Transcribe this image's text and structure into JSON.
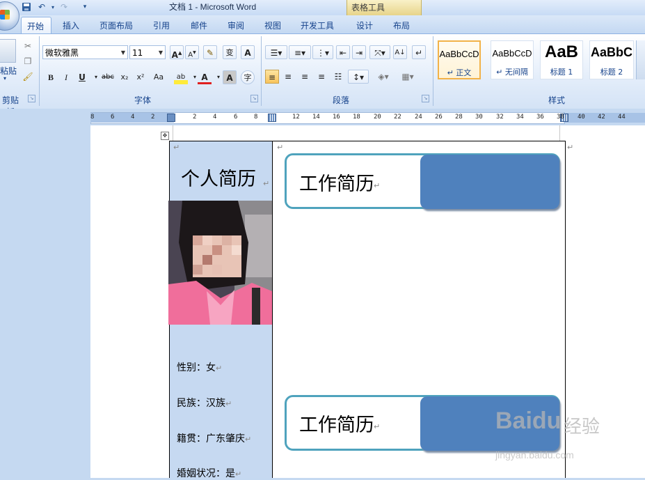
{
  "window": {
    "title": "文档 1 - Microsoft Word",
    "contextual_tools": "表格工具"
  },
  "tabs": [
    {
      "label": "开始",
      "active": true
    },
    {
      "label": "插入"
    },
    {
      "label": "页面布局"
    },
    {
      "label": "引用"
    },
    {
      "label": "邮件"
    },
    {
      "label": "审阅"
    },
    {
      "label": "视图"
    },
    {
      "label": "开发工具"
    },
    {
      "label": "设计"
    },
    {
      "label": "布局"
    }
  ],
  "ribbon": {
    "clipboard": {
      "label": "剪贴板",
      "paste_label": "粘贴"
    },
    "font": {
      "label": "字体",
      "font_name": "微软雅黑",
      "font_size": "11",
      "grow": "A",
      "shrink": "A",
      "bold": "B",
      "italic": "I",
      "underline": "U",
      "strike": "abc",
      "subscript": "x₂",
      "superscript": "x²",
      "change_case": "Aa",
      "highlight": "ab",
      "font_color": "A",
      "char_shading": "A",
      "enclose": "字",
      "phonetic": "变"
    },
    "paragraph": {
      "label": "段落"
    },
    "styles": {
      "label": "样式",
      "items": [
        {
          "sample": "AaBbCcD",
          "name": "↵ 正文",
          "selected": true
        },
        {
          "sample": "AaBbCcD",
          "name": "↵ 无间隔"
        },
        {
          "sample": "AaB",
          "name": "标题 1"
        },
        {
          "sample": "AaBbC",
          "name": "标题 2"
        }
      ]
    }
  },
  "ruler": {
    "left_ticks": [
      "8",
      "6",
      "4",
      "2"
    ],
    "right_ticks": [
      "2",
      "4",
      "6",
      "8",
      "12",
      "14",
      "16",
      "18",
      "20",
      "22",
      "24",
      "26",
      "28",
      "30",
      "32",
      "34",
      "36",
      "38",
      "40",
      "42",
      "44"
    ]
  },
  "document": {
    "title": "个人简历",
    "sections": [
      "工作简历",
      "工作简历"
    ],
    "info": [
      "性别：女",
      "民族：汉族",
      "籍贯：广东肇庆",
      "婚姻状况：是"
    ],
    "para_mark": "↵"
  },
  "watermark": {
    "logo": "Baidu",
    "text": "经验",
    "url": "jingyan.baidu.com"
  },
  "colors": {
    "ribbon_blue": "#c5d9f1",
    "cell_fill": "#c6d9f1",
    "section_frame": "#4fa3bd",
    "section_fill": "#4f81bd",
    "style_selected": "#f2b248"
  }
}
